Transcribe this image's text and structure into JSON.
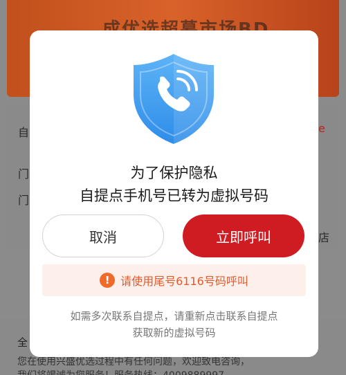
{
  "background": {
    "banner_title": "…成优选超募市场BD…",
    "side_texts": [
      "自",
      "门",
      "门"
    ],
    "side_right": [
      "e",
      "店"
    ],
    "footer_title": "全",
    "footer_line1": "您在使用兴盛优选过程中有任何问题，欢迎致电咨询，",
    "footer_line2": "我们将竭诚为您服务！服务热线：4009889997"
  },
  "modal": {
    "title_line1": "为了保护隐私",
    "title_line2": "自提点手机号已转为虚拟号码",
    "cancel_label": "取消",
    "call_label": "立即呼叫",
    "notice_icon": "!",
    "notice_text": "请使用尾号6116号码呼叫",
    "hint_line1": "如需多次联系自提点，请重新点击联系自提点",
    "hint_line2": "获取新的虚拟号码"
  },
  "colors": {
    "accent_red": "#cf1c22",
    "notice_bg": "#fdf0ea",
    "notice_text": "#e05a2e",
    "shield_blue": "#3a9bf0"
  },
  "icons": {
    "shield": "shield-phone-icon",
    "warning": "exclamation-circle-icon"
  }
}
